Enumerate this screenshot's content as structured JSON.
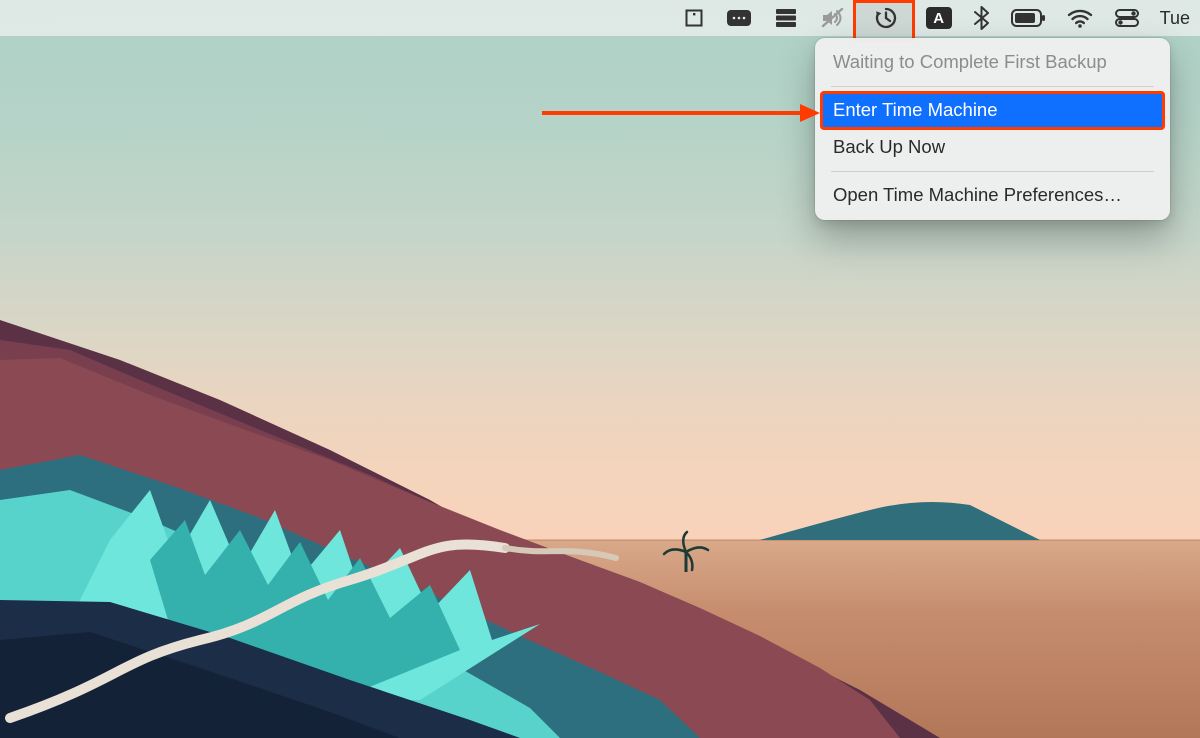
{
  "menubar": {
    "day_label": "Tue",
    "input_source_letter": "A"
  },
  "time_machine_menu": {
    "status": "Waiting to Complete First Backup",
    "items": [
      "Enter Time Machine",
      "Back Up Now"
    ],
    "preferences": "Open Time Machine Preferences…"
  },
  "annotation": {
    "highlight_color": "#fe3b00"
  }
}
